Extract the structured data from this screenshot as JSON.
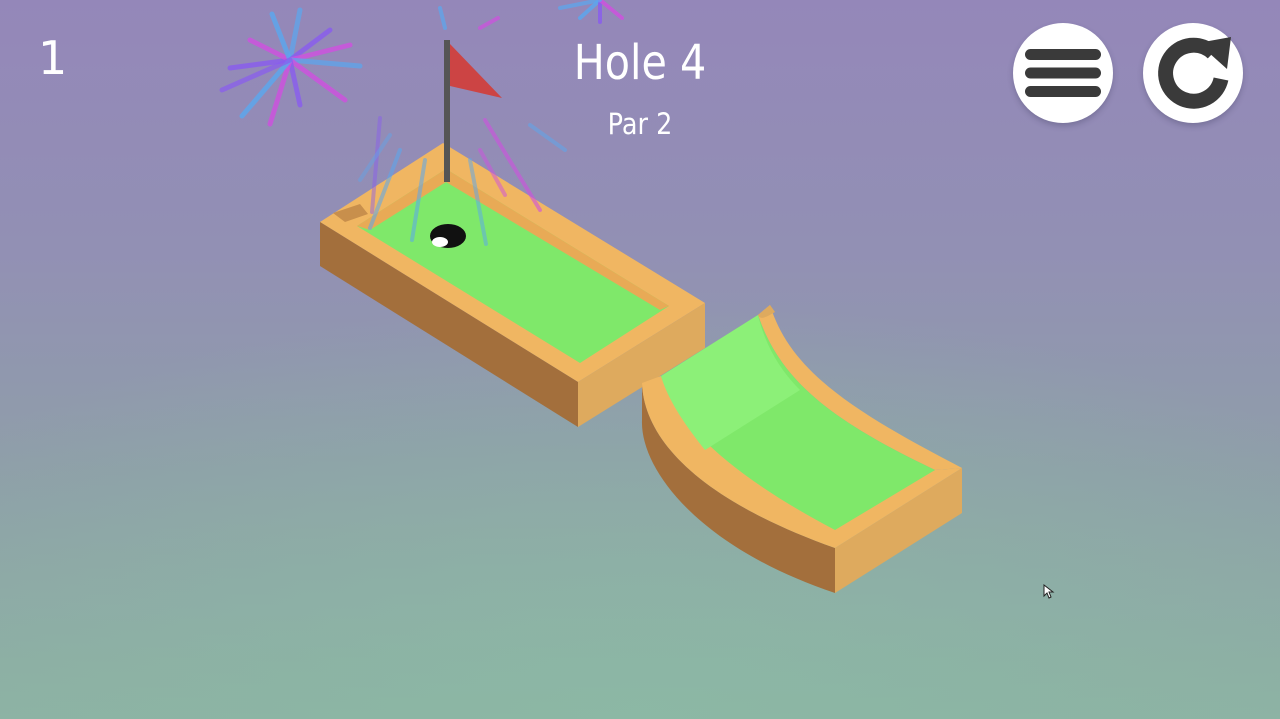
{
  "hud": {
    "stroke_count": "1",
    "hole_title": "Hole 4",
    "par_label": "Par 2"
  },
  "buttons": {
    "menu_icon": "hamburger-menu-icon",
    "restart_icon": "restart-arrow-icon"
  },
  "colors": {
    "grass": "#7fe86a",
    "grass_light": "#8cf078",
    "wall_top": "#f0b662",
    "wall_side_light": "#ddaa5e",
    "wall_side_dark": "#a36f3c",
    "flag": "#cc4444",
    "flag_pole": "#555555",
    "firework_blue": "#5aa8f0",
    "firework_pink": "#d050e0",
    "firework_purple": "#8a5cf0"
  }
}
